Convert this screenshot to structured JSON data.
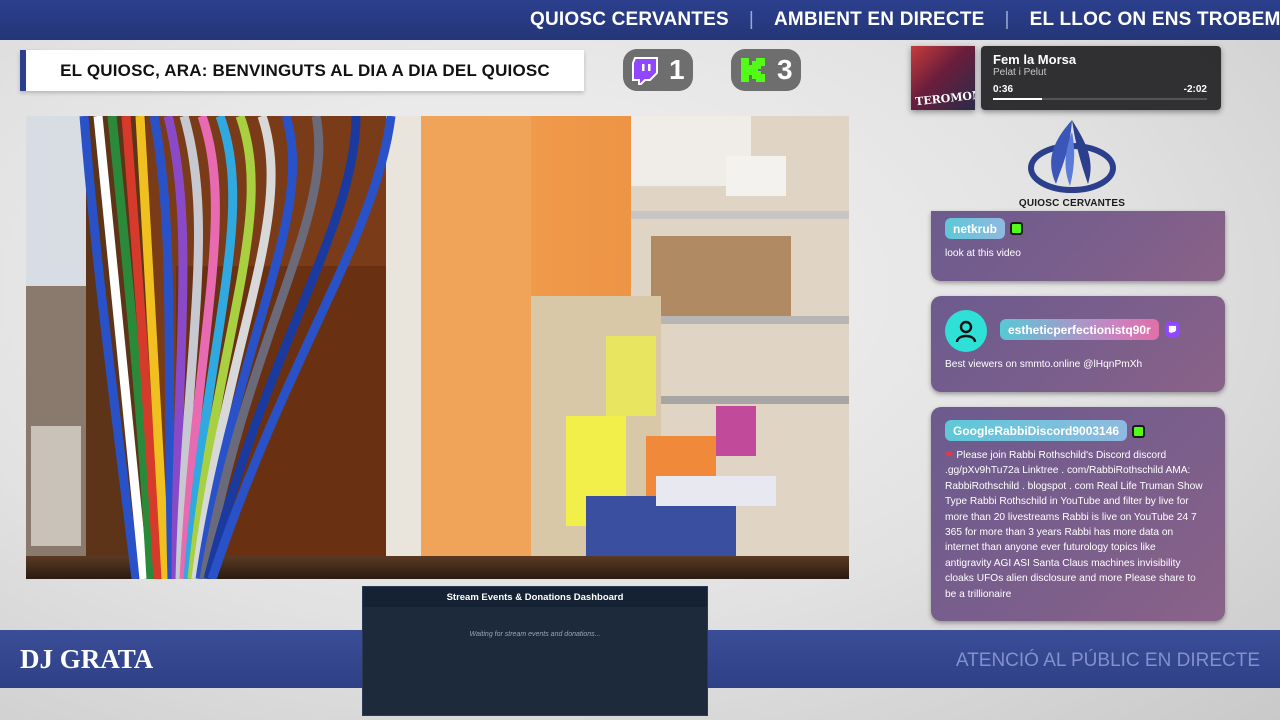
{
  "ticker": {
    "item1": "QUIOSC CERVANTES",
    "item2": "AMBIENT EN DIRECTE",
    "item3": "EL LLOC ON ENS TROBEM",
    "separator": "|"
  },
  "title": "EL QUIOSC, ARA: BENVINGUTS AL DIA A DIA DEL QUIOSC",
  "counters": {
    "twitch": "1",
    "kick": "3"
  },
  "now_playing": {
    "title": "Fem la Morsa",
    "artist": "Pelat i Pelut",
    "elapsed": "0:36",
    "remaining": "-2:02",
    "progress": 0.23,
    "album_art_text": "TEROMOMIX"
  },
  "logo": {
    "text": "QUIOSC CERVANTES"
  },
  "chat": [
    {
      "user": "netkrub",
      "badge": "kick",
      "text": "look at this video"
    },
    {
      "user": "estheticperfectionistq90r",
      "badge": "twitch",
      "text": "Best viewers on smmto.online @lHqnPmXh"
    },
    {
      "user": "GoogleRabbiDiscord9003146",
      "badge": "kick",
      "lines": [
        "Please join Rabbi Rothschild's Discord discord",
        ".gg/pXv9hTu72a Linktree . com/RabbiRothschild AMA:",
        "RabbiRothschild . blogspot . com Real Life Truman Show",
        "Type Rabbi Rothschild in YouTube and filter by live for",
        "more than 20 livestreams Rabbi is live on YouTube 24 7",
        "365 for more than 3 years Rabbi has more data on",
        "internet than anyone ever futurology topics like",
        "antigravity AGI ASI Santa Claus machines invisibility",
        "cloaks UFOs alien disclosure and more Please share to",
        "be a trillionaire"
      ]
    }
  ],
  "bottom": {
    "dj": "DJ GRATA",
    "right_text": "ATENCIÓ AL PÚBLIC EN DIRECTE"
  },
  "dashboard": {
    "title": "Stream Events & Donations Dashboard",
    "waiting": "Waiting for stream events and donations..."
  },
  "colors": {
    "brand_blue": "#2b3f8d",
    "chat_purple": "#7a5e8c",
    "kick_green": "#53fc18",
    "twitch_purple": "#9146ff"
  }
}
